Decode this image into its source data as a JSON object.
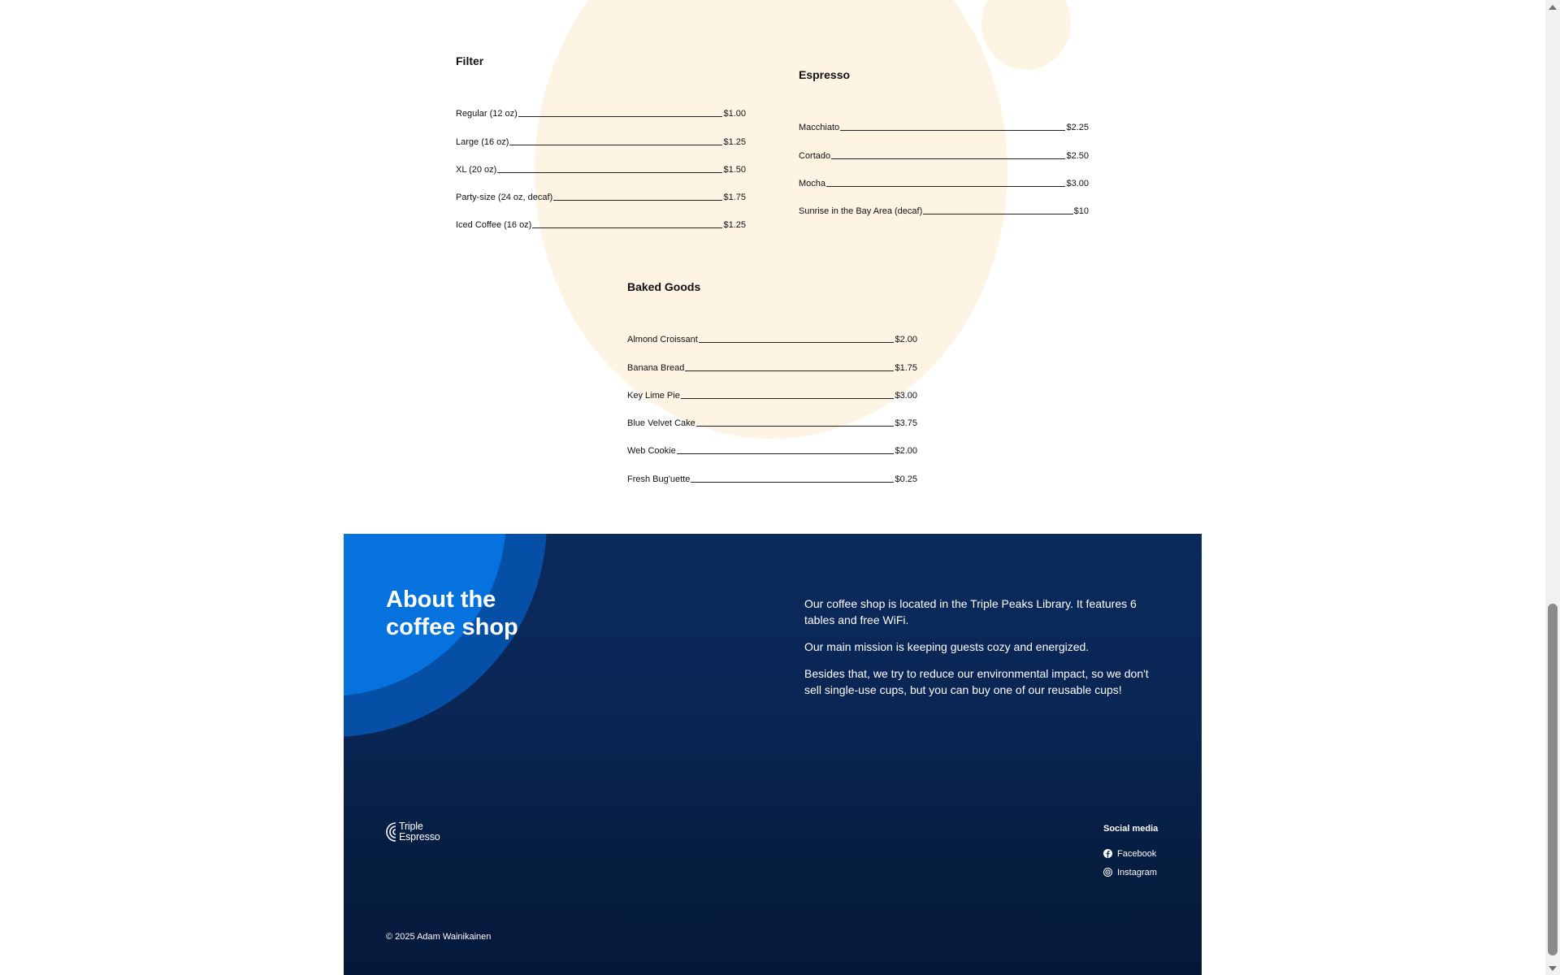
{
  "menu": {
    "filter": {
      "title": "Filter",
      "items": [
        {
          "name": "Regular (12 oz)",
          "price": "$1.00"
        },
        {
          "name": "Large (16 oz)",
          "price": "$1.25"
        },
        {
          "name": "XL (20 oz)",
          "price": "$1.50"
        },
        {
          "name": "Party-size (24 oz, decaf)",
          "price": "$1.75"
        },
        {
          "name": "Iced Coffee (16 oz)",
          "price": "$1.25"
        }
      ]
    },
    "espresso": {
      "title": "Espresso",
      "items": [
        {
          "name": "Macchiato",
          "price": "$2.25"
        },
        {
          "name": "Cortado",
          "price": "$2.50"
        },
        {
          "name": "Mocha",
          "price": "$3.00"
        },
        {
          "name": "Sunrise in the Bay Area (decaf)",
          "price": "$10"
        }
      ]
    },
    "baked": {
      "title": "Baked Goods",
      "items": [
        {
          "name": "Almond Croissant",
          "price": "$2.00"
        },
        {
          "name": "Banana Bread",
          "price": "$1.75"
        },
        {
          "name": "Key Lime Pie",
          "price": "$3.00"
        },
        {
          "name": "Blue Velvet Cake",
          "price": "$3.75"
        },
        {
          "name": "Web Cookie",
          "price": "$2.00"
        },
        {
          "name": "Fresh Bug'uette",
          "price": "$0.25"
        }
      ]
    }
  },
  "about": {
    "title_line1": "About the",
    "title_line2": "coffee shop",
    "paragraphs": [
      "Our coffee shop is located in the Triple Peaks Library. It features 6 tables and free WiFi.",
      "Our main mission is keeping guests cozy and energized.",
      "Besides that, we try to reduce our environmental impact, so we don't sell single-use cups, but you can buy one of our reusable cups!"
    ]
  },
  "footer": {
    "brand_line1": "Triple",
    "brand_line2": "Espresso",
    "social_title": "Social media",
    "social": [
      {
        "label": "Facebook",
        "icon": "facebook-icon"
      },
      {
        "label": "Instagram",
        "icon": "instagram-icon"
      }
    ],
    "copyright": "© 2025 Adam Wainikainen"
  },
  "colors": {
    "cream": "#fdf4e3",
    "navy": "#0a2a5c",
    "blue_bright": "#0572de",
    "blue_mid": "#0550a6"
  }
}
